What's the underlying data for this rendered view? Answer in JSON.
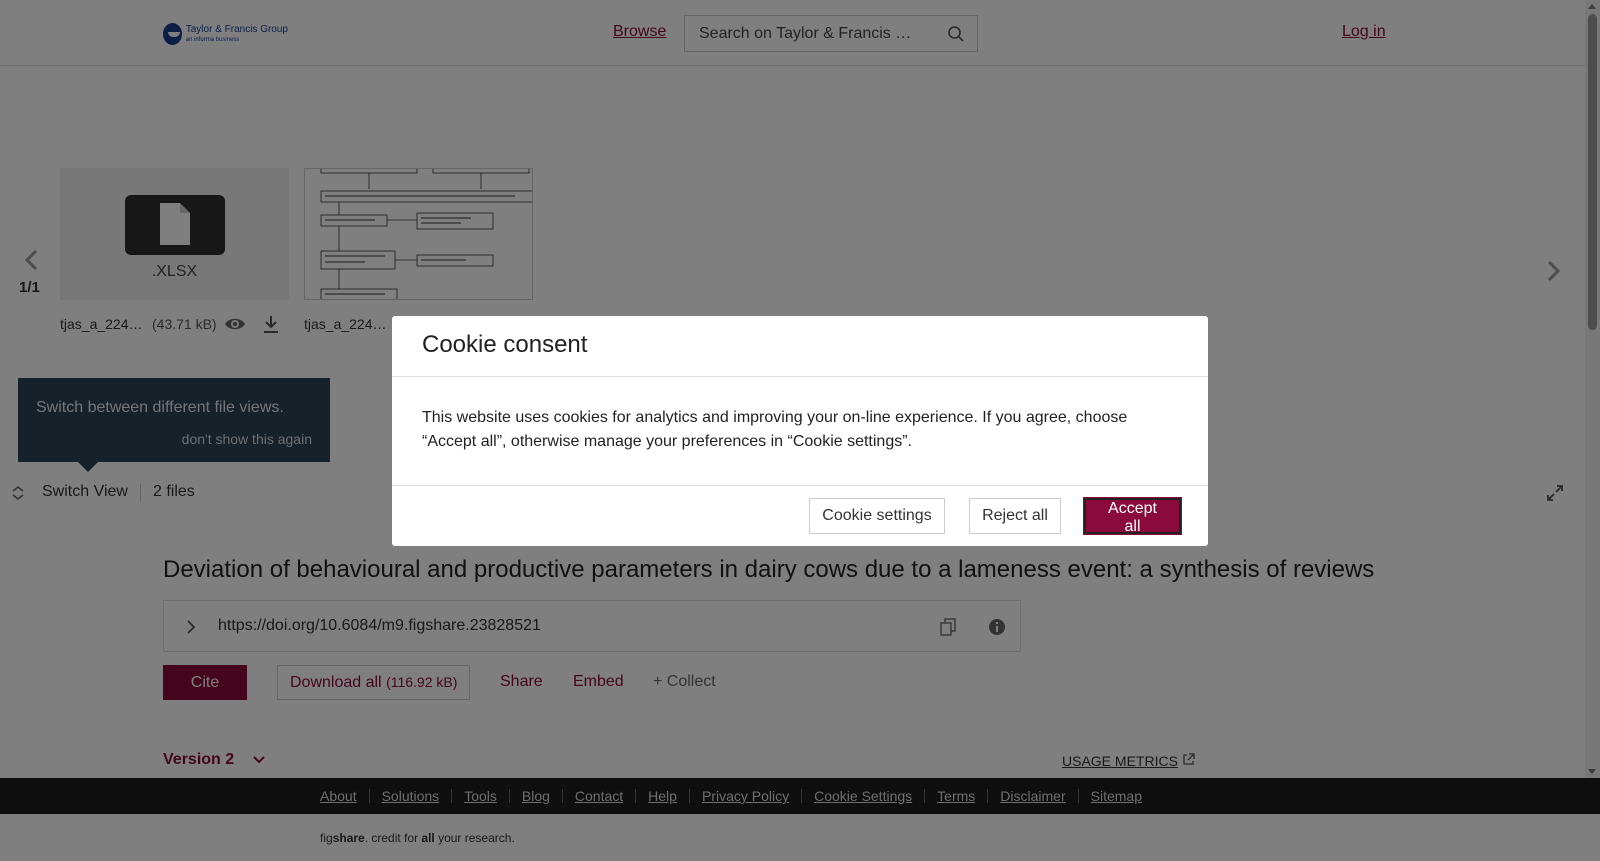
{
  "header": {
    "logo_title": "Taylor & Francis Group",
    "logo_sub": "an informa business",
    "browse_label": "Browse",
    "search_placeholder": "Search on Taylor & Francis …",
    "login_label": "Log in"
  },
  "files": {
    "counter": "1/1",
    "items": [
      {
        "name": "tjas_a_224…",
        "ext": ".XLSX",
        "size": "(43.71 kB)"
      },
      {
        "name": "tjas_a_224…"
      }
    ],
    "tooltip_text": "Switch between different file views.",
    "tooltip_dismiss": "don't show this again",
    "switch_view_label": "Switch View",
    "files_count": "2 files"
  },
  "article": {
    "title": "Deviation of behavioural and productive parameters in dairy cows due to a lameness event: a synthesis of reviews",
    "doi": "https://doi.org/10.6084/m9.figshare.23828521",
    "cite_label": "Cite",
    "download_all_label": "Download all",
    "download_all_size": "(116.92 kB)",
    "share_label": "Share",
    "embed_label": "Embed",
    "collect_label": "+ Collect",
    "version_label": "Version 2",
    "usage_metrics_label": "USAGE METRICS"
  },
  "footer": {
    "links": [
      "About",
      "Solutions",
      "Tools",
      "Blog",
      "Contact",
      "Help",
      "Privacy Policy",
      "Cookie Settings",
      "Terms",
      "Disclaimer",
      "Sitemap"
    ],
    "credit_prefix": "fig",
    "credit_brand": "share",
    "credit_mid": ". credit for ",
    "credit_all": "all",
    "credit_end": " your research."
  },
  "cookie_modal": {
    "title": "Cookie consent",
    "body": "This website uses cookies for analytics and improving your on-line experience. If you agree, choose “Accept all”, otherwise manage your preferences in “Cookie settings”.",
    "settings_label": "Cookie settings",
    "reject_label": "Reject all",
    "accept_label": "Accept all"
  },
  "colors": {
    "brand": "#8a0b3b",
    "footer_bg": "#1f1f1f",
    "tooltip_bg": "#2f4254"
  }
}
